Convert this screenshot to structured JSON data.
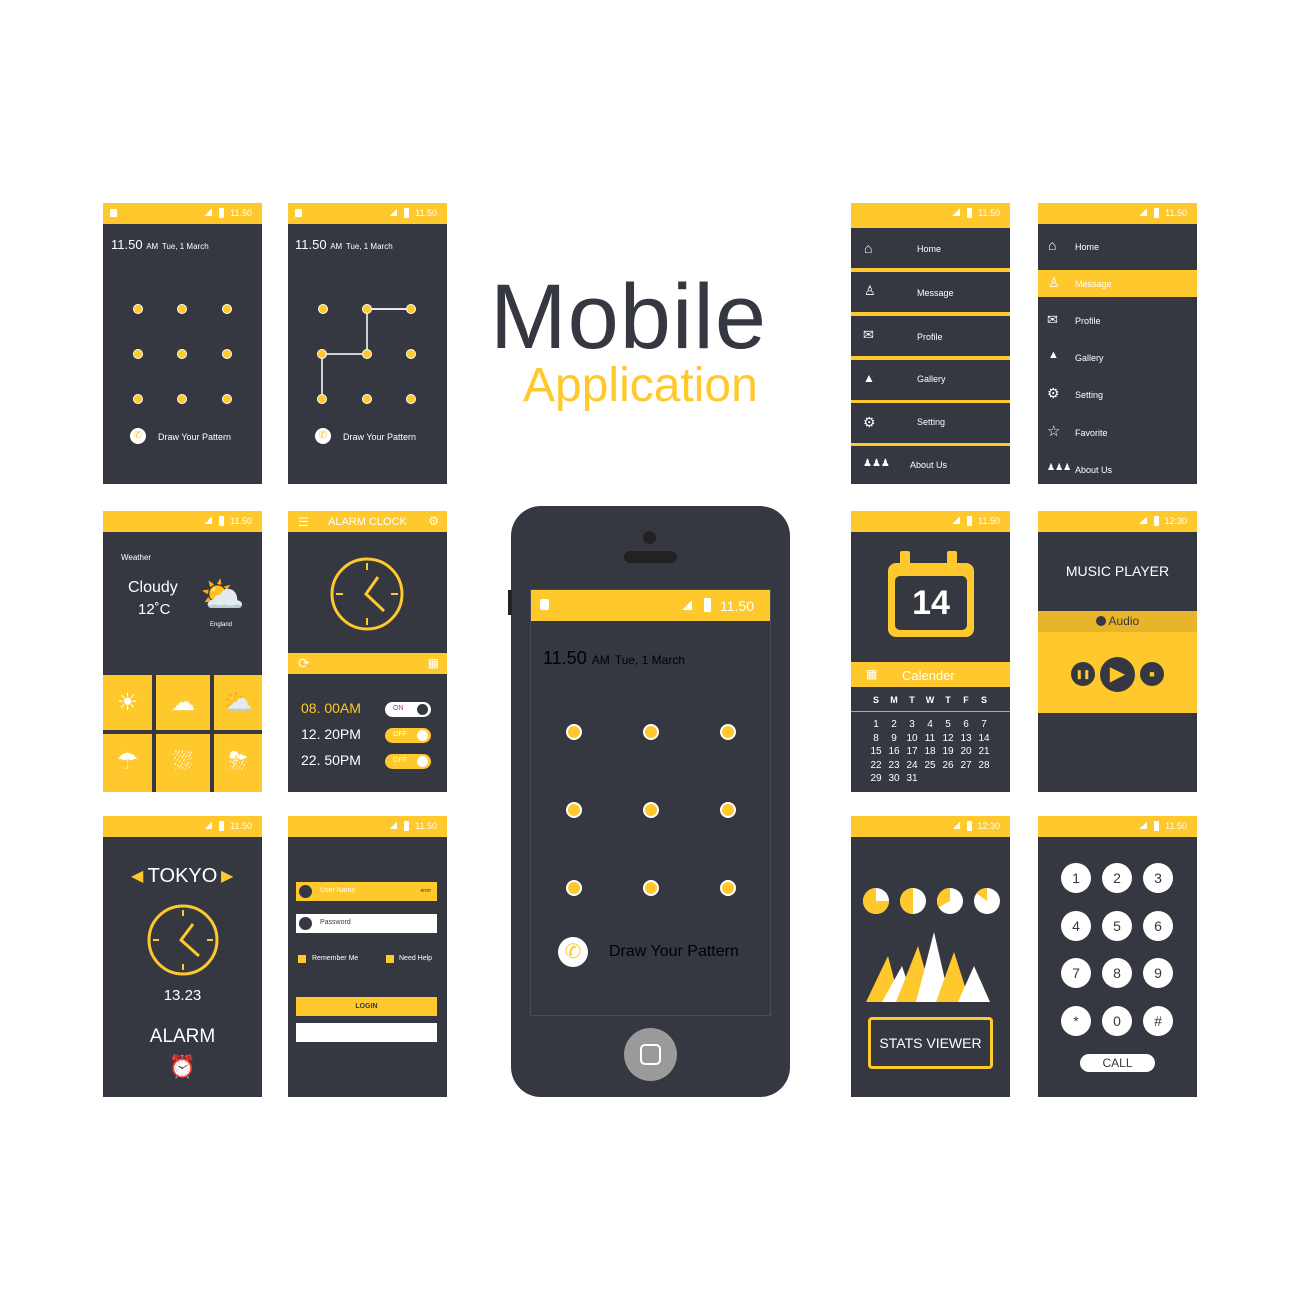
{
  "title": {
    "main": "Mobile",
    "sub": "Application"
  },
  "colors": {
    "accent": "#FFC82C",
    "dark": "#353840"
  },
  "status": {
    "time": "11.50",
    "time_alt": "12:30"
  },
  "lock_screen": {
    "time": "11.50",
    "ampm": "AM",
    "date": "Tue, 1 March",
    "hint": "Draw Your Pattern"
  },
  "menu": {
    "items": [
      "Home",
      "Message",
      "Profile",
      "Gallery",
      "Setting",
      "About Us"
    ]
  },
  "menu2": {
    "items": [
      "Home",
      "Message",
      "Profile",
      "Gallery",
      "Setting",
      "Favorite",
      "About Us"
    ],
    "active": "Message"
  },
  "weather": {
    "label": "Weather",
    "condition": "Cloudy",
    "temp": "12˚C",
    "location": "England"
  },
  "alarm_clock": {
    "title": "ALARM CLOCK",
    "alarms": [
      {
        "time": "08. 00AM",
        "state": "ON"
      },
      {
        "time": "12. 20PM",
        "state": "OFF"
      },
      {
        "time": "22. 50PM",
        "state": "OFF"
      }
    ]
  },
  "calendar": {
    "day": "14",
    "title": "Calender",
    "weekdays": [
      "S",
      "M",
      "T",
      "W",
      "T",
      "F",
      "S"
    ],
    "days": [
      "1",
      "2",
      "3",
      "4",
      "5",
      "6",
      "7",
      "8",
      "9",
      "10",
      "11",
      "12",
      "13",
      "14",
      "15",
      "16",
      "17",
      "18",
      "19",
      "20",
      "21",
      "22",
      "23",
      "24",
      "25",
      "26",
      "27",
      "28",
      "29",
      "30",
      "31"
    ]
  },
  "music": {
    "title": "MUSIC PLAYER",
    "source": "Audio"
  },
  "world_clock": {
    "city": "TOKYO",
    "time": "13.23",
    "label": "ALARM"
  },
  "login": {
    "username_placeholder": "User Name",
    "username_error": "error",
    "password_placeholder": "Password",
    "remember": "Remember Me",
    "help": "Need Help",
    "login_label": "LOGIN"
  },
  "stats": {
    "label": "STATS VIEWER",
    "pie_fractions": [
      0.75,
      0.5,
      0.33,
      0.15
    ]
  },
  "dialer": {
    "keys": [
      "1",
      "2",
      "3",
      "4",
      "5",
      "6",
      "7",
      "8",
      "9",
      "*",
      "0",
      "#"
    ],
    "call": "CALL"
  }
}
